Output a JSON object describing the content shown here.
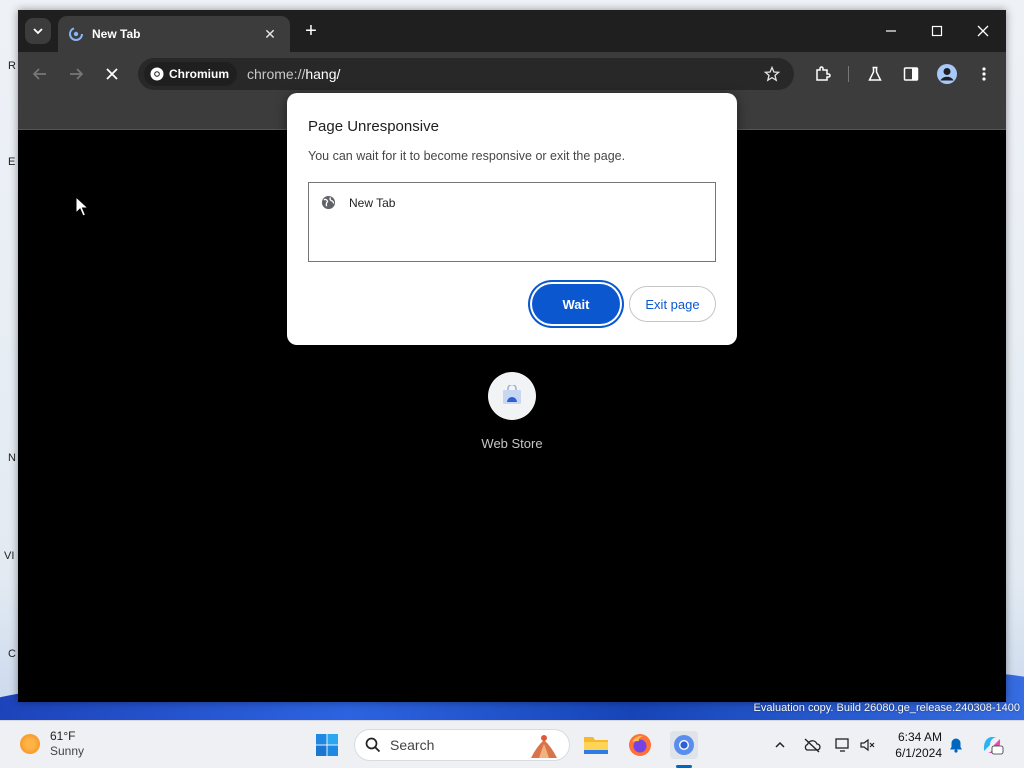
{
  "browser": {
    "tab": {
      "title": "New Tab"
    },
    "omnibox": {
      "chip_label": "Chromium",
      "url_scheme": "chrome://",
      "url_host": "hang/"
    }
  },
  "dialog": {
    "title": "Page Unresponsive",
    "message": "You can wait for it to become responsive or exit the page.",
    "pages": [
      {
        "title": "New Tab"
      }
    ],
    "wait_label": "Wait",
    "exit_label": "Exit page"
  },
  "newtab": {
    "shortcut_label": "Web Store"
  },
  "desktop": {
    "watermark": "Evaluation copy. Build 26080.ge_release.240308-1400",
    "fragments": [
      "R",
      "E",
      "N",
      "VI",
      "C"
    ]
  },
  "taskbar": {
    "weather_temp": "61°F",
    "weather_cond": "Sunny",
    "search_placeholder": "Search",
    "time": "6:34 AM",
    "date": "6/1/2024"
  },
  "colors": {
    "accent": "#0b57d0",
    "toolbar": "#3c3c3c",
    "tabstrip": "#1f1f1f"
  }
}
